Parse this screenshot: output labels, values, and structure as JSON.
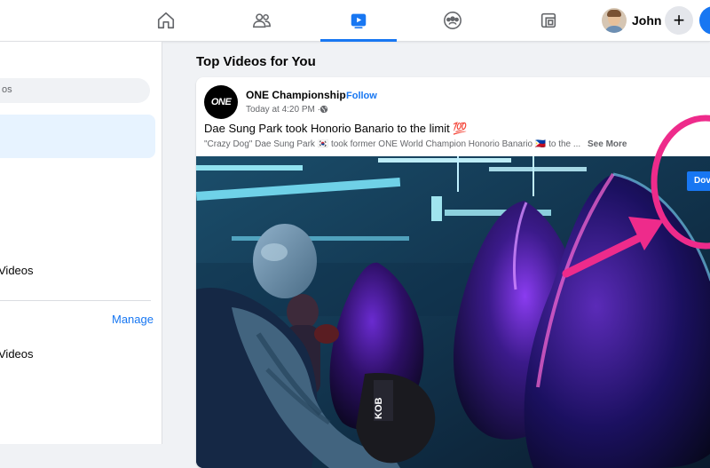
{
  "topbar": {
    "tabs": [
      {
        "name": "home",
        "icon": "home-icon",
        "active": false
      },
      {
        "name": "friends",
        "icon": "friends-icon",
        "active": false
      },
      {
        "name": "watch",
        "icon": "video-play-icon",
        "active": true
      },
      {
        "name": "groups",
        "icon": "groups-icon",
        "active": false
      },
      {
        "name": "gaming",
        "icon": "gaming-icon",
        "active": false
      }
    ],
    "profile_name": "John",
    "create_symbol": "+",
    "accent_color": "#1877f2"
  },
  "sidebar": {
    "search_placeholder": "os",
    "videos_label_1": "Videos",
    "manage_label": "Manage",
    "videos_label_2": "Videos"
  },
  "feed": {
    "section_title": "Top Videos for You",
    "post": {
      "page_name": "ONE Championship",
      "page_logo_text": "ONE",
      "separator": "·",
      "follow_label": "Follow",
      "timestamp": "Today at 4:20 PM · ",
      "title": "Dae Sung Park took Honorio Banario to the limit 💯",
      "snippet": "\"Crazy Dog\" Dae Sung Park 🇰🇷 took former ONE World Champion Honorio Banario 🇵🇭 to the ...",
      "see_more": "See More",
      "video_overlay_button": "Dov",
      "glove_text": "KOB"
    }
  },
  "annotation": {
    "color": "#ee2b8b",
    "shape": "circle-with-arrow"
  }
}
